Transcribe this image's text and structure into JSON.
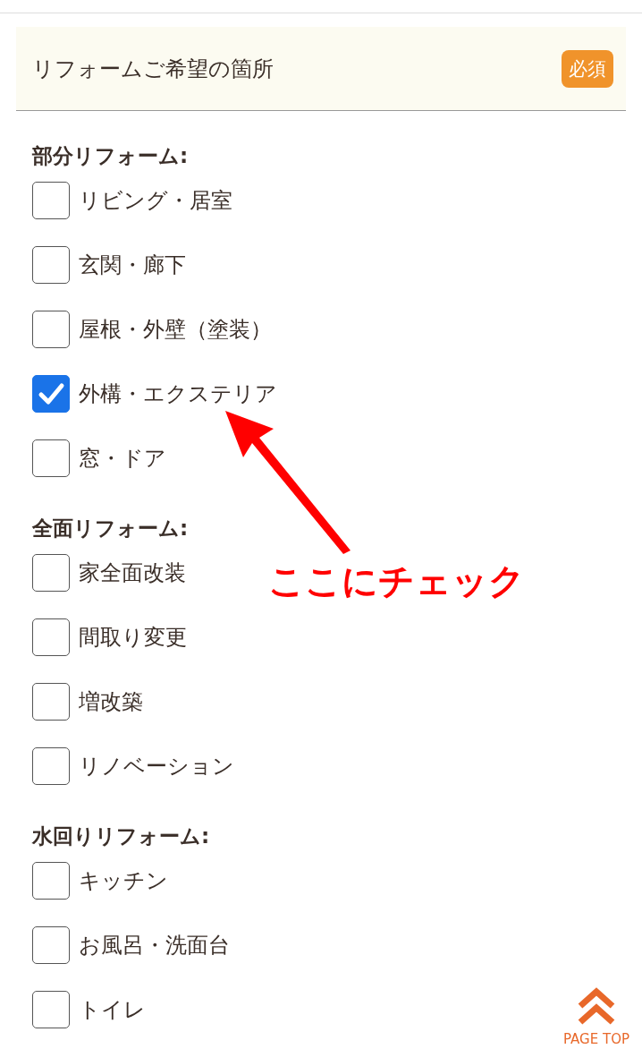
{
  "section": {
    "title": "リフォームご希望の箇所",
    "badge": "必須"
  },
  "groups": [
    {
      "heading": "部分リフォーム:",
      "options": [
        {
          "label": "リビング・居室",
          "checked": false
        },
        {
          "label": "玄関・廊下",
          "checked": false
        },
        {
          "label": "屋根・外壁（塗装）",
          "checked": false
        },
        {
          "label": "外構・エクステリア",
          "checked": true
        },
        {
          "label": "窓・ドア",
          "checked": false
        }
      ]
    },
    {
      "heading": "全面リフォーム:",
      "options": [
        {
          "label": "家全面改装",
          "checked": false
        },
        {
          "label": "間取り変更",
          "checked": false
        },
        {
          "label": "増改築",
          "checked": false
        },
        {
          "label": "リノベーション",
          "checked": false
        }
      ]
    },
    {
      "heading": "水回りリフォーム:",
      "options": [
        {
          "label": "キッチン",
          "checked": false
        },
        {
          "label": "お風呂・洗面台",
          "checked": false
        },
        {
          "label": "トイレ",
          "checked": false
        }
      ]
    }
  ],
  "annotation": {
    "text": "ここにチェック"
  },
  "page_top": {
    "label": "PAGE TOP"
  }
}
